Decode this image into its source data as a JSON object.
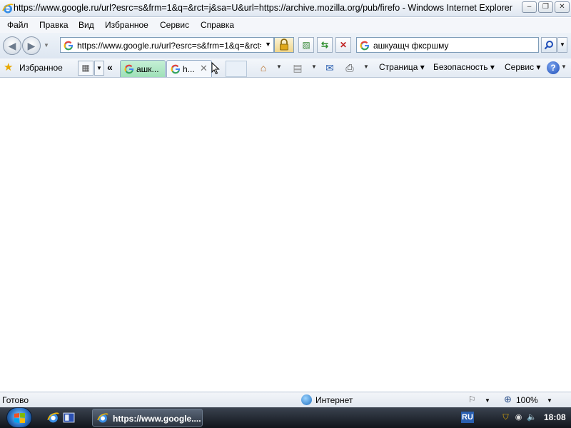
{
  "window": {
    "title": "https://www.google.ru/url?esrc=s&frm=1&q=&rct=j&sa=U&url=https://archive.mozilla.org/pub/firefo - Windows Internet Explorer",
    "minimize_symbol": "–",
    "maximize_symbol": "❐",
    "close_symbol": "✕"
  },
  "menu": [
    "Файл",
    "Правка",
    "Вид",
    "Избранное",
    "Сервис",
    "Справка"
  ],
  "address": {
    "url": "https://www.google.ru/url?esrc=s&frm=1&q=&rct=j&sa=U&url=https://archive.mozilla.org/pub/firefo",
    "search_query": "ашкуащч фкcршму"
  },
  "toolbar": {
    "favorites_label": "Избранное",
    "tabs": [
      {
        "label": "ашк..."
      },
      {
        "label": "h..."
      }
    ],
    "page_label": "Страница",
    "safety_label": "Безопасность",
    "tools_label": "Сервис"
  },
  "status": {
    "text": "Готово",
    "zone": "Интернет",
    "zoom": "100%"
  },
  "taskbar": {
    "task_label": "https://www.google....",
    "language": "RU",
    "time": "18:08"
  },
  "colors": {
    "active_tab": "#9fe0b8",
    "accent": "#1f6fc0"
  }
}
